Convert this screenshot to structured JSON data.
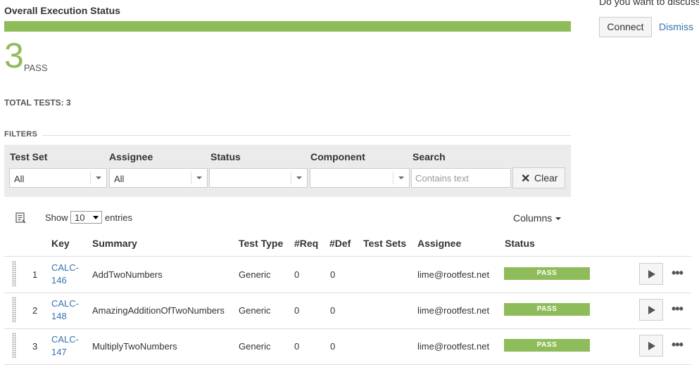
{
  "overall": {
    "title": "Overall Execution Status",
    "pass_fraction": 1.0,
    "pass_count": "3",
    "pass_label": "PASS",
    "bar_color": "#8fbc5a"
  },
  "total_tests": "TOTAL TESTS: 3",
  "filters": {
    "title": "FILTERS",
    "test_set": {
      "label": "Test Set",
      "value": "All"
    },
    "assignee": {
      "label": "Assignee",
      "value": "All"
    },
    "status": {
      "label": "Status",
      "value": ""
    },
    "component": {
      "label": "Component",
      "value": ""
    },
    "search": {
      "label": "Search",
      "value": "",
      "placeholder": "Contains text"
    },
    "clear_label": "Clear"
  },
  "table_controls": {
    "show_label": "Show",
    "entries_value": "10",
    "entries_label": "entries",
    "columns_label": "Columns"
  },
  "table": {
    "headers": {
      "key": "Key",
      "summary": "Summary",
      "test_type": "Test Type",
      "req": "#Req",
      "def": "#Def",
      "test_sets": "Test Sets",
      "assignee": "Assignee",
      "status": "Status"
    },
    "rows": [
      {
        "index": "1",
        "key_line1": "CALC-",
        "key_line2": "146",
        "summary": "AddTwoNumbers",
        "test_type": "Generic",
        "req": "0",
        "def": "0",
        "test_sets": "",
        "assignee": "lime@rootfest.net",
        "status": "PASS"
      },
      {
        "index": "2",
        "key_line1": "CALC-",
        "key_line2": "148",
        "summary": "AmazingAdditionOfTwoNumbers",
        "test_type": "Generic",
        "req": "0",
        "def": "0",
        "test_sets": "",
        "assignee": "lime@rootfest.net",
        "status": "PASS"
      },
      {
        "index": "3",
        "key_line1": "CALC-",
        "key_line2": "147",
        "summary": "MultiplyTwoNumbers",
        "test_type": "Generic",
        "req": "0",
        "def": "0",
        "test_sets": "",
        "assignee": "lime@rootfest.net",
        "status": "PASS"
      }
    ]
  },
  "discuss_panel": {
    "text": "Do you want to discuss",
    "connect_label": "Connect",
    "dismiss_label": "Dismiss"
  },
  "icons": {
    "list": "list-icon",
    "clear": "close-icon",
    "play": "play-icon",
    "more": "more-icon",
    "drag": "drag-handle-icon"
  },
  "colors": {
    "pass": "#8fbc5a",
    "link": "#3572b0"
  }
}
